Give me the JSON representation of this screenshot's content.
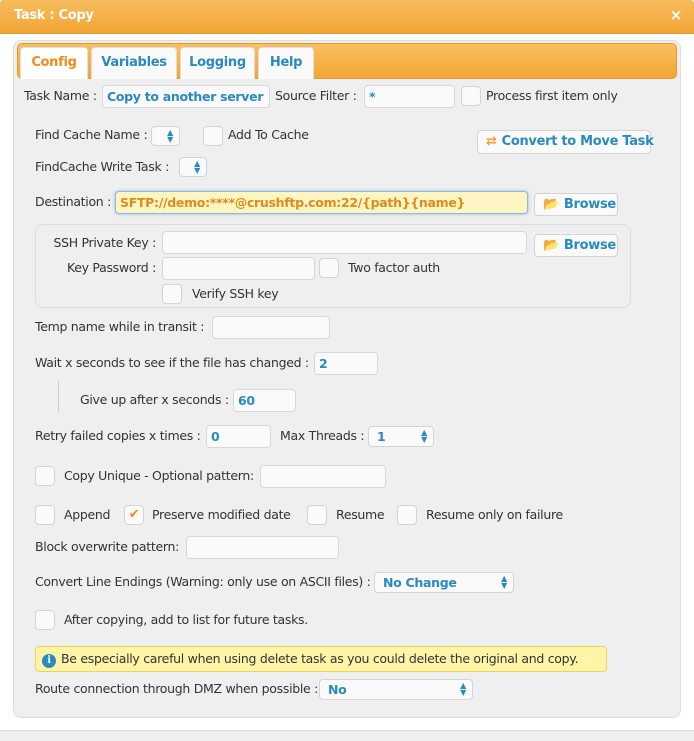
{
  "window": {
    "title": "Task : Copy",
    "close_icon": "×"
  },
  "tabs": [
    {
      "label": "Config",
      "active": true
    },
    {
      "label": "Variables"
    },
    {
      "label": "Logging"
    },
    {
      "label": "Help"
    }
  ],
  "form": {
    "task_name_label": "Task Name :",
    "task_name_value": "Copy to another server",
    "source_filter_label": "Source Filter :",
    "source_filter_value": "*",
    "process_first_label": "Process first item only",
    "process_first_checked": false,
    "find_cache_label": "Find Cache Name :",
    "add_to_cache_label": "Add To Cache",
    "add_to_cache_checked": false,
    "convert_button": "Convert to Move Task",
    "findcache_write_label": "FindCache Write Task :",
    "destination_label": "Destination :",
    "destination_value": "SFTP://demo:****@crushftp.com:22/{path}{name}",
    "browse_label": "Browse",
    "ssh_key_label": "SSH Private Key :",
    "ssh_key_value": "",
    "key_password_label": "Key Password :",
    "key_password_value": "",
    "two_factor_label": "Two factor auth",
    "two_factor_checked": false,
    "verify_ssh_label": "Verify SSH key",
    "verify_ssh_checked": false,
    "temp_name_label": "Temp name while in transit :",
    "temp_name_value": "",
    "wait_label": "Wait x seconds to see if the file has changed :",
    "wait_value": "2",
    "give_up_label": "Give up after x seconds :",
    "give_up_value": "60",
    "retry_label": "Retry failed copies x times :",
    "retry_value": "0",
    "max_threads_label": "Max Threads :",
    "max_threads_value": "1",
    "copy_unique_label": "Copy Unique - Optional pattern:",
    "copy_unique_checked": false,
    "copy_unique_value": "",
    "append_label": "Append",
    "append_checked": false,
    "preserve_label": "Preserve modified date",
    "preserve_checked": true,
    "resume_label": "Resume",
    "resume_checked": false,
    "resume_failure_label": "Resume only on failure",
    "resume_failure_checked": false,
    "block_overwrite_label": "Block overwrite pattern:",
    "block_overwrite_value": "",
    "line_endings_label": "Convert Line Endings (Warning: only use on ASCII files) :",
    "line_endings_value": "No Change",
    "after_copy_label": "After copying, add to list for future tasks.",
    "after_copy_checked": false,
    "info_text": "Be especially careful when using delete task as you could delete the original and copy.",
    "dmz_label": "Route connection through DMZ when possible :",
    "dmz_value": "No"
  },
  "colors": {
    "accent": "#f2a635",
    "link": "#2a8ac0",
    "active_tab": "#f08a1c",
    "info_bg": "#fff5a8"
  }
}
